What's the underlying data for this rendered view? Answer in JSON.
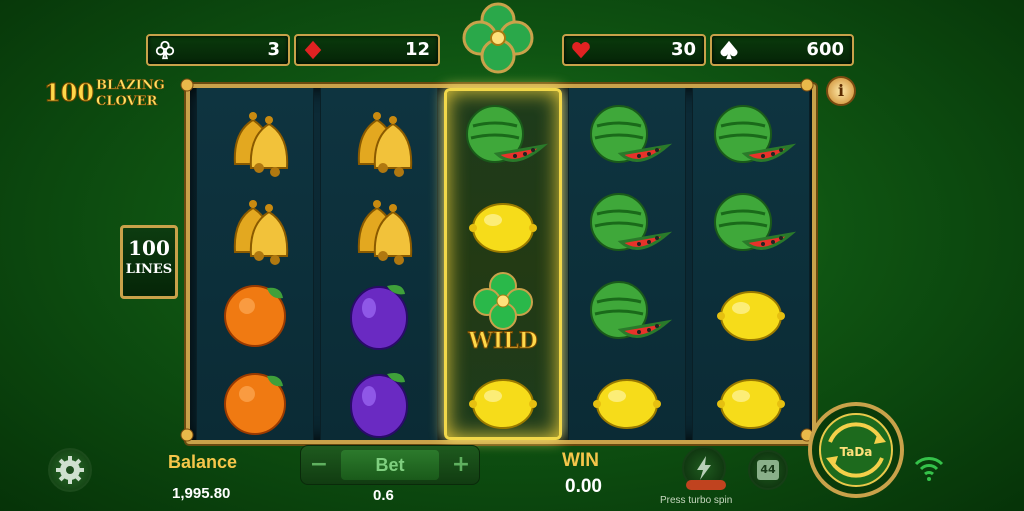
{
  "counters": [
    {
      "suit": "club",
      "value": "3"
    },
    {
      "suit": "diamond",
      "value": "12"
    },
    {
      "suit": "heart",
      "value": "30"
    },
    {
      "suit": "spade",
      "value": "600"
    }
  ],
  "logo": {
    "number": "100",
    "line1": "BLAZING",
    "line2": "CLOVER"
  },
  "info_label": "i",
  "lines_badge": {
    "number": "100",
    "label": "LINES"
  },
  "reels": [
    [
      "bell",
      "bell",
      "orange",
      "orange"
    ],
    [
      "bell",
      "bell",
      "plum",
      "plum"
    ],
    [
      "watermelon",
      "lemon",
      "wild",
      "lemon"
    ],
    [
      "watermelon",
      "watermelon",
      "watermelon",
      "lemon"
    ],
    [
      "watermelon",
      "watermelon",
      "lemon",
      "lemon"
    ]
  ],
  "highlighted_reel": 2,
  "wild_label": "WILD",
  "balance": {
    "label": "Balance",
    "value": "1,995.80"
  },
  "bet": {
    "label": "Bet",
    "value": "0.6",
    "minus": "−",
    "plus": "+"
  },
  "win": {
    "label": "WIN",
    "value": "0.00"
  },
  "turbo_label": "Press turbo spin",
  "auto_spin_count": "44",
  "spin_button_label": "TaDa",
  "colors": {
    "gold": "#c9a24a",
    "bg": "#0f5412",
    "accent": "#f5c64a"
  }
}
